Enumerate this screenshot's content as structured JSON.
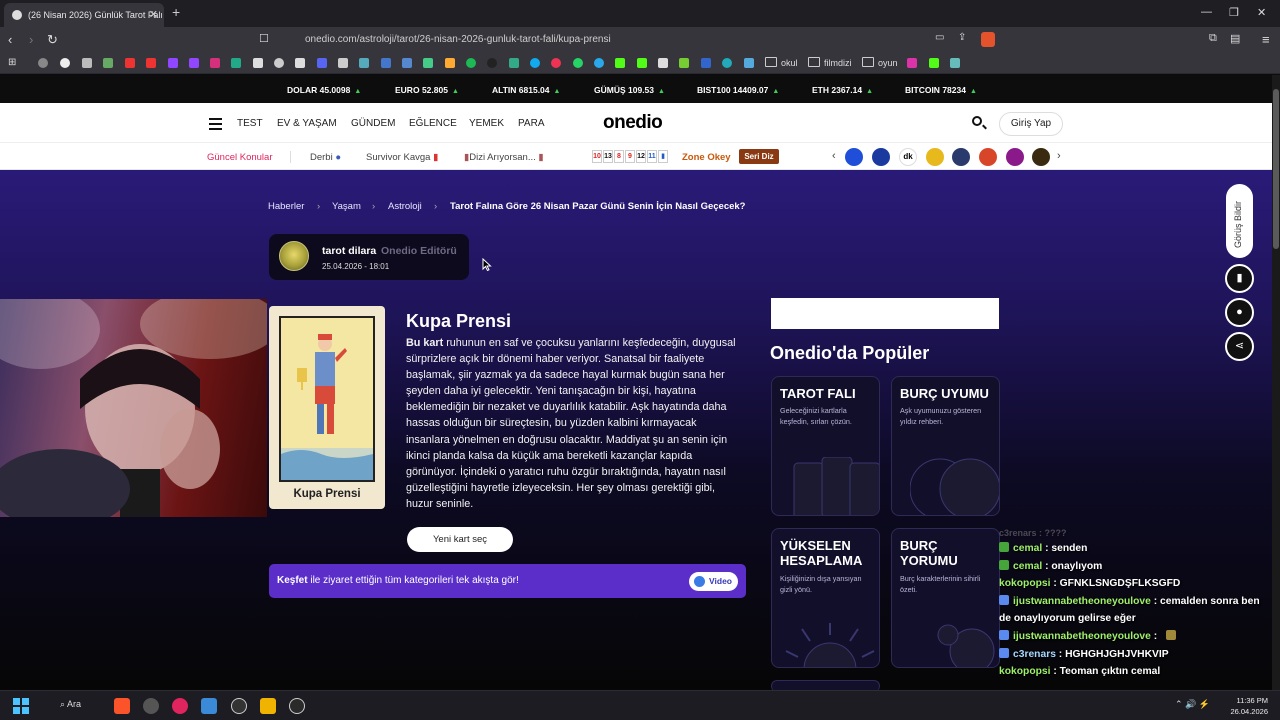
{
  "browser": {
    "tab_title": "(26 Nisan 2026) Günlük Tarot Falı",
    "url": "onedio.com/astroloji/tarot/26-nisan-2026-gunluk-tarot-fali/kupa-prensi",
    "bookmark_folders": [
      "okul",
      "filmdizi",
      "oyun"
    ]
  },
  "ticker": [
    {
      "label": "DOLAR",
      "value": "45.0098"
    },
    {
      "label": "EURO",
      "value": "52.805"
    },
    {
      "label": "ALTIN",
      "value": "6815.04"
    },
    {
      "label": "GÜMÜŞ",
      "value": "109.53"
    },
    {
      "label": "BIST100",
      "value": "14409.07"
    },
    {
      "label": "ETH",
      "value": "2367.14"
    },
    {
      "label": "BITCOIN",
      "value": "78234"
    }
  ],
  "header": {
    "nav": [
      "TEST",
      "EV & YAŞAM",
      "GÜNDEM",
      "EĞLENCE",
      "YEMEK",
      "PARA"
    ],
    "logo": "onedio",
    "login_label": "Giriş Yap"
  },
  "topics": {
    "label": "Güncel Konular",
    "items": [
      "Derbi",
      "Survivor Kavga",
      "Dizi Arıyorsan..."
    ],
    "zone_label": "Zone Okey",
    "zone_badge": "Seri Diz",
    "zone_tiles": [
      "10",
      "13",
      "8",
      "9",
      "12",
      "11"
    ]
  },
  "breadcrumb": [
    "Haberler",
    "Yaşam",
    "Astroloji",
    "Tarot Falına Göre 26 Nisan Pazar Günü Senin İçin Nasıl Geçecek?"
  ],
  "author": {
    "name": "tarot dilara",
    "role": "Onedio Editörü",
    "date": "25.04.2026 - 18:01"
  },
  "card": {
    "caption": "Kupa Prensi",
    "title": "Kupa Prensi",
    "lead": "Bu kart",
    "body": " ruhunun en saf ve çocuksu yanlarını keşfedeceğin, duygusal sürprizlere açık bir dönemi haber veriyor. Sanatsal bir faaliyete başlamak, şiir yazmak ya da sadece hayal kurmak bugün sana her şeyden daha iyi gelecektir. Yeni tanışacağın bir kişi, hayatına beklemediğin bir nezaket ve duyarlılık katabilir. Aşk hayatında daha hassas olduğun bir süreçtesin, bu yüzden kalbini kırmayacak insanlara yönelmen en doğrusu olacaktır. Maddiyat şu an senin için ikinci planda kalsa da küçük ama bereketli kazançlar kapıda görünüyor. İçindeki o yaratıcı ruhu özgür bıraktığında, hayatın nasıl güzelleştiğini hayretle izleyeceksin. Her şey olması gerektiği gibi, huzur seninle.",
    "new_card_label": "Yeni kart seç"
  },
  "promo": {
    "bold": "Keşfet",
    "text": " ile ziyaret ettiğin tüm kategorileri tek akışta gör!",
    "video_label": "Video"
  },
  "popular": {
    "heading": "Onedio'da Popüler",
    "cards": [
      {
        "title": "TAROT FALI",
        "desc": "Geleceğinizi kartlarla keşfedin, sırları çözün."
      },
      {
        "title": "BURÇ UYUMU",
        "desc": "Aşk uyumunuzu gösteren yıldız rehberi."
      },
      {
        "title": "YÜKSELEN HESAPLAMA",
        "desc": "Kişiliğinizin dışa yansıyan gizli yönü."
      },
      {
        "title": "BURÇ YORUMU",
        "desc": "Burç karakterlerinin sihirli özeti."
      }
    ]
  },
  "floating": {
    "feedback_label": "Görüş Bildir"
  },
  "chat": [
    {
      "user": "cemal",
      "msg": "senden",
      "color": "#9ff06a"
    },
    {
      "user": "cemal",
      "msg": "onaylıyom",
      "color": "#9ff06a"
    },
    {
      "user": "kokopopsi",
      "msg": "GFNKLSNGDŞFLKSGFD",
      "color": "#9ff06a"
    },
    {
      "user": "ijustwannabetheoneyoulove",
      "msg": "cemalden sonra ben de onaylıyorum gelirse eğer",
      "color": "#9ff06a"
    },
    {
      "user": "ijustwannabetheoneyoulove",
      "msg": "",
      "color": "#9ff06a"
    },
    {
      "user": "c3renars",
      "msg": "HGHGHJGHJVHKVIP",
      "color": "#a7d8ff"
    },
    {
      "user": "kokopopsi",
      "msg": "Teoman çıktın cemal",
      "color": "#9ff06a"
    }
  ],
  "taskbar": {
    "search_label": "Ara",
    "time": "11:36 PM",
    "date": "26.04.2026"
  }
}
